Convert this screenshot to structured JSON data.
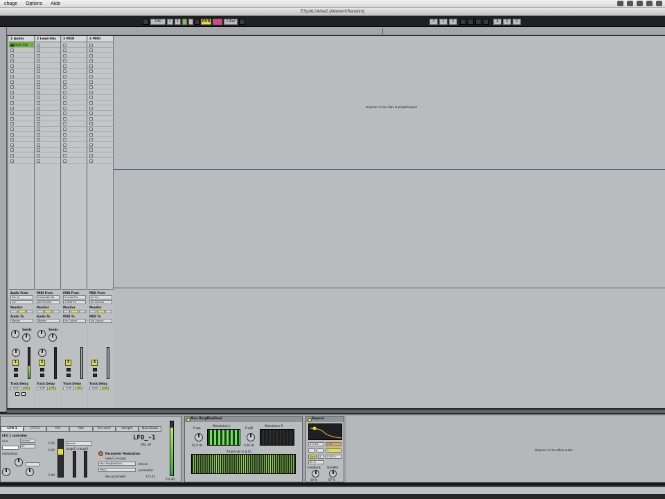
{
  "menu": {
    "items": [
      "chage",
      "Options",
      "Aide"
    ]
  },
  "window": {
    "title": "ESpritLfoMax2  [AbletonKRandom]"
  },
  "transport": {
    "tempo": "140",
    "sig_num": "1",
    "sig_den": "1",
    "ovr_label": "OVR",
    "quantize": "1 Bar",
    "position_bars": "3",
    "position_beats": "1",
    "position_sixteenths": "1",
    "loop_length": "4",
    "loop_beats": "0",
    "loop_sixteenths": "0"
  },
  "tracks": [
    {
      "name": "1 Audio",
      "number": "1",
      "io_from_label": "Audio From",
      "io_from": "Ext. In",
      "io_channel": "1/2",
      "monitor_label": "Monitor",
      "io_to_label": "Audio To",
      "io_to": "Master",
      "sends_label": "Sends",
      "delay_label": "Track Delay",
      "delay_value": "0.00",
      "delay_unit": "ms",
      "has_clip": true,
      "clip_name": "Audio Clip"
    },
    {
      "name": "2 Lead-Shs",
      "number": "2",
      "io_from_label": "MIDI From",
      "io_from": "Computer Ke",
      "io_channel": "All Channe",
      "monitor_label": "Monitor",
      "io_to_label": "Audio To",
      "io_to": "Master",
      "sends_label": "Sends",
      "delay_label": "Track Delay",
      "delay_value": "0.00",
      "delay_unit": "ms",
      "has_clip": false,
      "clip_name": ""
    },
    {
      "name": "3 MIDI",
      "number": "3",
      "io_from_label": "MIDI From",
      "io_from": "2 Lead-Shs",
      "io_channel": "1-Post FX",
      "monitor_label": "Monitor",
      "io_to_label": "MIDI To",
      "io_to": "No Output",
      "sends_label": "",
      "delay_label": "Track Delay",
      "delay_value": "0.00",
      "delay_unit": "ms",
      "has_clip": false,
      "clip_name": ""
    },
    {
      "name": "4 MIDI",
      "number": "4",
      "io_from_label": "MIDI From",
      "io_from": "All Ins",
      "io_channel": "All Channe",
      "monitor_label": "Monitor",
      "io_to_label": "MIDI To",
      "io_to": "No Output",
      "sends_label": "",
      "delay_label": "Track Delay",
      "delay_value": "0.00",
      "delay_unit": "ms",
      "has_clip": false,
      "clip_name": ""
    }
  ],
  "session_drop_message": "Déposez ici les clips et périphériques",
  "device_drop_message": "Déposez ici les effets audio",
  "lfo_device": {
    "tabs": [
      "LFO 1",
      "LFO 2",
      "Rt1",
      "Rt4",
      "Rnr-sont",
      "sample",
      "QuickLook"
    ],
    "active_tab": 0,
    "title": "LFO_-1",
    "subtitle": "DAC off",
    "controller_label": "LFO 1 controller",
    "shape_label": "sine",
    "mode_value": "normal",
    "rate_value": "4n",
    "modulation_label": "modulation",
    "min_label": "0.26",
    "max_label": "0.26",
    "bottom_value": "0.00",
    "polarity_value": "bipolar",
    "range_label": "range1 / range2",
    "param_mod_label": "Parameter Modulation",
    "select_label": "select / re-load",
    "device_select": "Max RingModDual",
    "param_select": "Freq L",
    "device_label": "device",
    "parameter_label": "parameter",
    "see_param_label": "See parameter",
    "param_value": "173.33",
    "output_db": "0.0 dB"
  },
  "ring_device": {
    "title": "Max RingModDual",
    "freq_l_label": "FreqL",
    "freq_l_value": "93.0 Hz",
    "mod_l_label": "Modulation L",
    "freq_r_label": "FreqR",
    "freq_r_value": "0.00 Hz",
    "mod_r_label": "Modulation R",
    "amp_label": "Amplitude (L & R)"
  },
  "repeat_device": {
    "title": "Repeat",
    "val1": "173 Hz",
    "val2": "1 %",
    "val3": "1",
    "sync_label": "Sync",
    "sync_value": "4",
    "pct": "0.00 %",
    "pct2": "50 %",
    "feedback_label": "Feedback",
    "feedback_value": "50 %",
    "drywet_label": "Dry/Wet",
    "drywet_value": "67 %"
  },
  "colors": {
    "clip_green": "#6fb33c",
    "arm_yellow": "#e4df38",
    "ovr_yellow": "#e5e033",
    "pink": "#e53e8c"
  }
}
